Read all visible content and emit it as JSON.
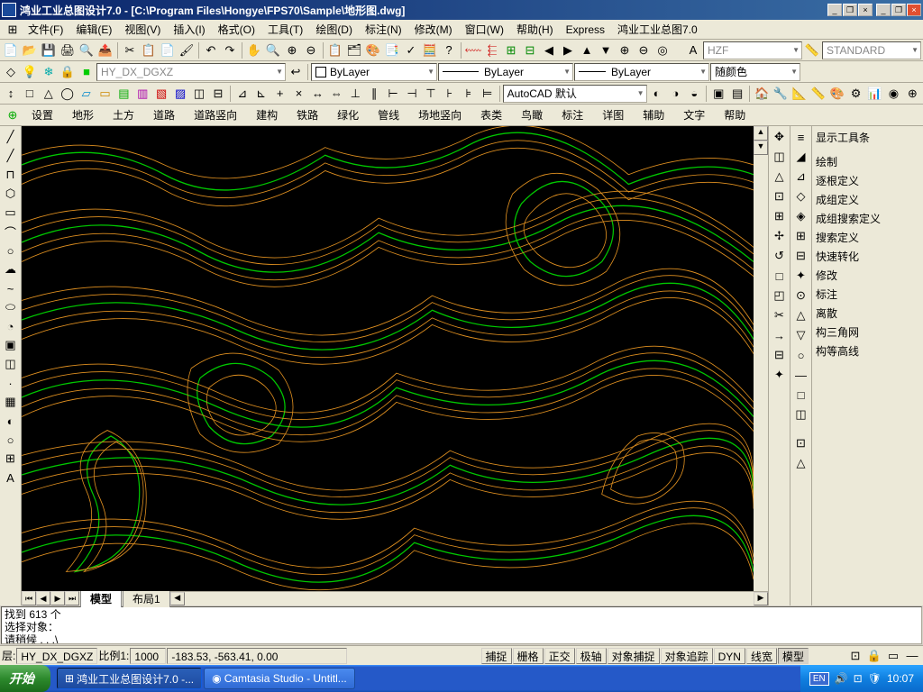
{
  "window": {
    "title": "鸿业工业总图设计7.0 - [C:\\Program Files\\Hongye\\FPS70\\Sample\\地形图.dwg]",
    "min": "_",
    "max": "❐",
    "close": "×"
  },
  "menus": [
    "文件(F)",
    "编辑(E)",
    "视图(V)",
    "插入(I)",
    "格式(O)",
    "工具(T)",
    "绘图(D)",
    "标注(N)",
    "修改(M)",
    "窗口(W)",
    "帮助(H)",
    "Express",
    "鸿业工业总图7.0"
  ],
  "toolbar1_icons": [
    "□",
    "🖿",
    "💾",
    "🖨",
    "🔍",
    "✂",
    "📋",
    "📄",
    "↶",
    "↷",
    "↯",
    "✎",
    "🔧",
    "|",
    "A",
    "▭",
    "◐",
    "▦",
    "◧",
    "⊞",
    "?",
    "|",
    "⬳",
    "⬱",
    "⇤",
    "⇥",
    "◀",
    "▶",
    "▲",
    "▼",
    "⊕",
    "⊖",
    "◎"
  ],
  "layer_combo": "HY_DX_DGXZ",
  "linetype_combo": "ByLayer",
  "lineweight_combo": "ByLayer",
  "plotstyle_combo": "ByLayer",
  "color_combo": "随颜色",
  "font_combo": "HZF",
  "dimstyle_combo": "STANDARD",
  "cmd_combo": "AutoCAD 默认",
  "toolbar_row3_icons": [
    "↕",
    "□",
    "△",
    "◯",
    "▱",
    "▭",
    "▤",
    "▥",
    "▧",
    "▨",
    "◫",
    "⊟",
    "|",
    "⊿",
    "⊾",
    "+",
    "×",
    "↔",
    "⇔",
    "⊥",
    "∥",
    "⊢",
    "⊣",
    "⊤",
    "⊦",
    "⊧",
    "⊨",
    "⊩",
    "⊪"
  ],
  "toolbar_row3_right_icons": [
    "◐",
    "◑",
    "◒",
    "◓",
    "|",
    "▣",
    "▤",
    "|",
    "🏠",
    "🔧",
    "📐",
    "📏",
    "🎨",
    "⚙",
    "📊",
    "◉",
    "⊕"
  ],
  "subtabs": [
    "设置",
    "地形",
    "土方",
    "道路",
    "道路竖向",
    "建构",
    "铁路",
    "绿化",
    "管线",
    "场地竖向",
    "表类",
    "鸟瞰",
    "标注",
    "详图",
    "辅助",
    "文字",
    "帮助"
  ],
  "left_tools": [
    "╱",
    "╱",
    "⊓",
    "⌒",
    "○",
    "◯",
    "⬭",
    "~",
    "⊂",
    "◔",
    "□",
    "·",
    "A",
    "▦",
    "◐",
    "○",
    "▭",
    "⊞",
    "□",
    "A"
  ],
  "mid_right_tools": [
    "✥",
    "◫",
    "△",
    "+",
    "⊞",
    "□",
    "◯",
    "△",
    "⊡",
    "✂",
    "⊡",
    "↺",
    "⊕"
  ],
  "right_tools": [
    "≡",
    "◢",
    "⊿",
    "◇",
    "◈",
    "⊞",
    "⊟",
    "✦",
    "⊙",
    "△",
    "▽",
    "○",
    "—",
    "□",
    "◫",
    "—",
    "⊡",
    "△"
  ],
  "right_panel": {
    "header": "显示工具条",
    "items": [
      "绘制",
      "逐根定义",
      "成组定义",
      "成组搜索定义",
      "搜索定义",
      "快速转化",
      "修改",
      "标注",
      "离散",
      "构三角网",
      "构等高线"
    ]
  },
  "tabs": {
    "model": "模型",
    "layout1": "布局1"
  },
  "command_lines": [
    "找到 613 个",
    "选择对象：",
    "请稍候 . . .\\"
  ],
  "status": {
    "layer_label": "层:",
    "layer": "HY_DX_DGXZ",
    "scale_label": "比例1:",
    "scale": "1000",
    "coords": "-183.53, -563.41, 0.00",
    "toggles": [
      "捕捉",
      "栅格",
      "正交",
      "极轴",
      "对象捕捉",
      "对象追踪",
      "DYN",
      "线宽",
      "模型"
    ]
  },
  "taskbar": {
    "start": "开始",
    "tasks": [
      "鸿业工业总图设计7.0 -...",
      "Camtasia Studio - Untitl..."
    ],
    "tray_lang": "EN",
    "clock": "10:07"
  }
}
